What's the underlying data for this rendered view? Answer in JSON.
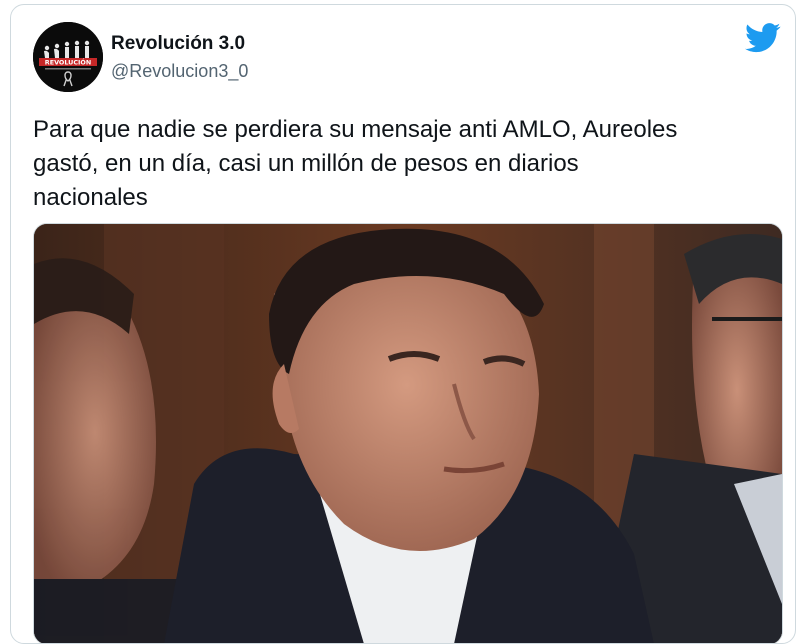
{
  "tweet": {
    "display_name": "Revolución 3.0",
    "handle": "@Revolucion3_0",
    "text": "Para que nadie se perdiera su mensaje anti AMLO, Aureoles\ngastó, en un día, casi un millón de pesos en diarios\nnacionales"
  },
  "avatar": {
    "logo_text": "REVOLUCIÓN",
    "icon": "evolution-silhouettes-logo"
  },
  "icons": {
    "brand": "twitter-bird-icon",
    "ribbon": "black-ribbon-icon"
  },
  "media": {
    "description_type": "photo"
  },
  "colors": {
    "twitter_blue": "#1d9bf0",
    "text_primary": "#0f1419",
    "text_secondary": "#536471",
    "border": "#cfd9de"
  }
}
